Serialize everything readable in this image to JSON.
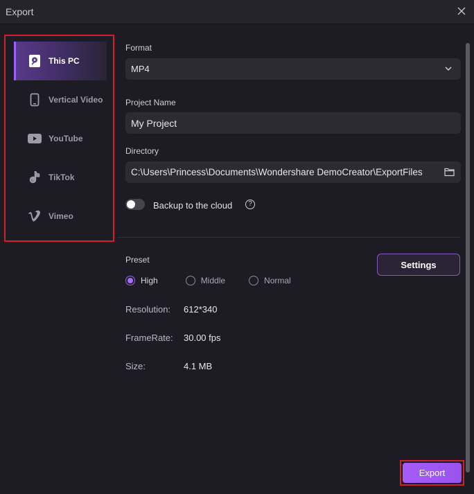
{
  "window": {
    "title": "Export"
  },
  "sidebar": {
    "items": [
      {
        "label": "This PC",
        "icon": "pc-icon",
        "active": true
      },
      {
        "label": "Vertical Video",
        "icon": "phone-icon",
        "active": false
      },
      {
        "label": "YouTube",
        "icon": "youtube-icon",
        "active": false
      },
      {
        "label": "TikTok",
        "icon": "tiktok-icon",
        "active": false
      },
      {
        "label": "Vimeo",
        "icon": "vimeo-icon",
        "active": false
      }
    ]
  },
  "form": {
    "format_label": "Format",
    "format_value": "MP4",
    "project_name_label": "Project Name",
    "project_name_value": "My Project",
    "directory_label": "Directory",
    "directory_value": "C:\\Users\\Princess\\Documents\\Wondershare DemoCreator\\ExportFiles",
    "backup_label": "Backup to the cloud",
    "backup_enabled": false,
    "help_glyph": "?"
  },
  "preset": {
    "label": "Preset",
    "options": [
      {
        "label": "High",
        "checked": true
      },
      {
        "label": "Middle",
        "checked": false
      },
      {
        "label": "Normal",
        "checked": false
      }
    ],
    "settings_label": "Settings"
  },
  "info": {
    "resolution_label": "Resolution:",
    "resolution_value": "612*340",
    "framerate_label": "FrameRate:",
    "framerate_value": "30.00 fps",
    "size_label": "Size:",
    "size_value": "4.1 MB"
  },
  "actions": {
    "export_label": "Export"
  },
  "colors": {
    "accent": "#9b63f2",
    "highlight_border": "#d3202a"
  }
}
